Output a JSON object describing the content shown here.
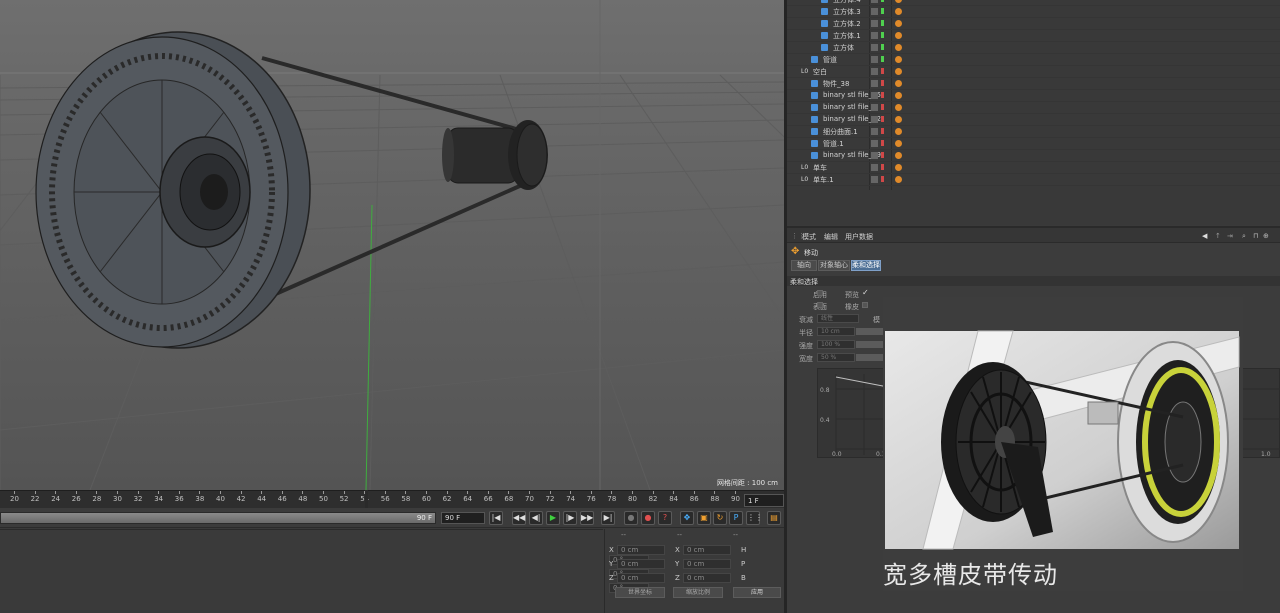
{
  "viewport": {
    "grid_readout": "网格间距 : 100 cm"
  },
  "timeline": {
    "ticks": [
      "20",
      "22",
      "24",
      "26",
      "28",
      "30",
      "32",
      "34",
      "36",
      "38",
      "40",
      "42",
      "44",
      "46",
      "48",
      "50",
      "52",
      "54",
      "56",
      "58",
      "60",
      "62",
      "64",
      "66",
      "68",
      "70",
      "72",
      "74",
      "76",
      "78",
      "80",
      "82",
      "84",
      "86",
      "88",
      "90"
    ],
    "current_frame": "1 F"
  },
  "transport": {
    "scrub_value": "90 F",
    "end_field": "90 F"
  },
  "coords": {
    "header_a": "--",
    "header_b": "--",
    "header_c": "--",
    "rows": [
      {
        "a_label": "X",
        "a_val": "0 cm",
        "b_label": "X",
        "b_val": "0 cm",
        "c_label": "H",
        "c_val": "0 °"
      },
      {
        "a_label": "Y",
        "a_val": "0 cm",
        "b_label": "Y",
        "b_val": "0 cm",
        "c_label": "P",
        "c_val": "0 °"
      },
      {
        "a_label": "Z",
        "a_val": "0 cm",
        "b_label": "Z",
        "b_val": "0 cm",
        "c_label": "B",
        "c_val": "0 °"
      }
    ],
    "world_btn": "世界坐标",
    "scale_btn": "缩放比例",
    "apply_btn": "应用"
  },
  "objects": {
    "items": [
      {
        "name": "立方体.4",
        "indent": 2
      },
      {
        "name": "立方体.3",
        "indent": 2
      },
      {
        "name": "立方体.2",
        "indent": 2
      },
      {
        "name": "立方体.1",
        "indent": 2
      },
      {
        "name": "立方体",
        "indent": 2
      },
      {
        "name": "管道",
        "indent": 1
      },
      {
        "name": "空白",
        "indent": 0
      },
      {
        "name": "物件_38",
        "indent": 1
      },
      {
        "name": "binary stl file_25",
        "indent": 1
      },
      {
        "name": "binary stl file_8",
        "indent": 1
      },
      {
        "name": "binary stl file_22",
        "indent": 1
      },
      {
        "name": "细分曲面.1",
        "indent": 1
      },
      {
        "name": "管道.1",
        "indent": 1
      },
      {
        "name": "binary stl file_19",
        "indent": 1
      },
      {
        "name": "单车",
        "indent": 0
      },
      {
        "name": "单车.1",
        "indent": 0
      }
    ]
  },
  "attributes": {
    "menu": [
      "模式",
      "编辑",
      "用户数据"
    ],
    "tool_title": "移动",
    "tabs": [
      "轴向",
      "对象轴心",
      "柔和选择"
    ],
    "section": "柔和选择",
    "labels": {
      "enable": "启用",
      "preview": "预览",
      "surface": "表面",
      "rubber": "橡皮",
      "falloff": "衰减",
      "falloff_val": "线性",
      "mode": "模",
      "radius": "半径",
      "radius_val": "10 cm",
      "strength": "强度",
      "strength_val": "100 %",
      "width": "宽度",
      "width_val": "50 %"
    },
    "graph_y": [
      "0.8",
      "0.4",
      "0.0"
    ],
    "graph_x": [
      "0.0",
      "0.1",
      "1.0"
    ]
  },
  "caption": "宽多槽皮带传动"
}
